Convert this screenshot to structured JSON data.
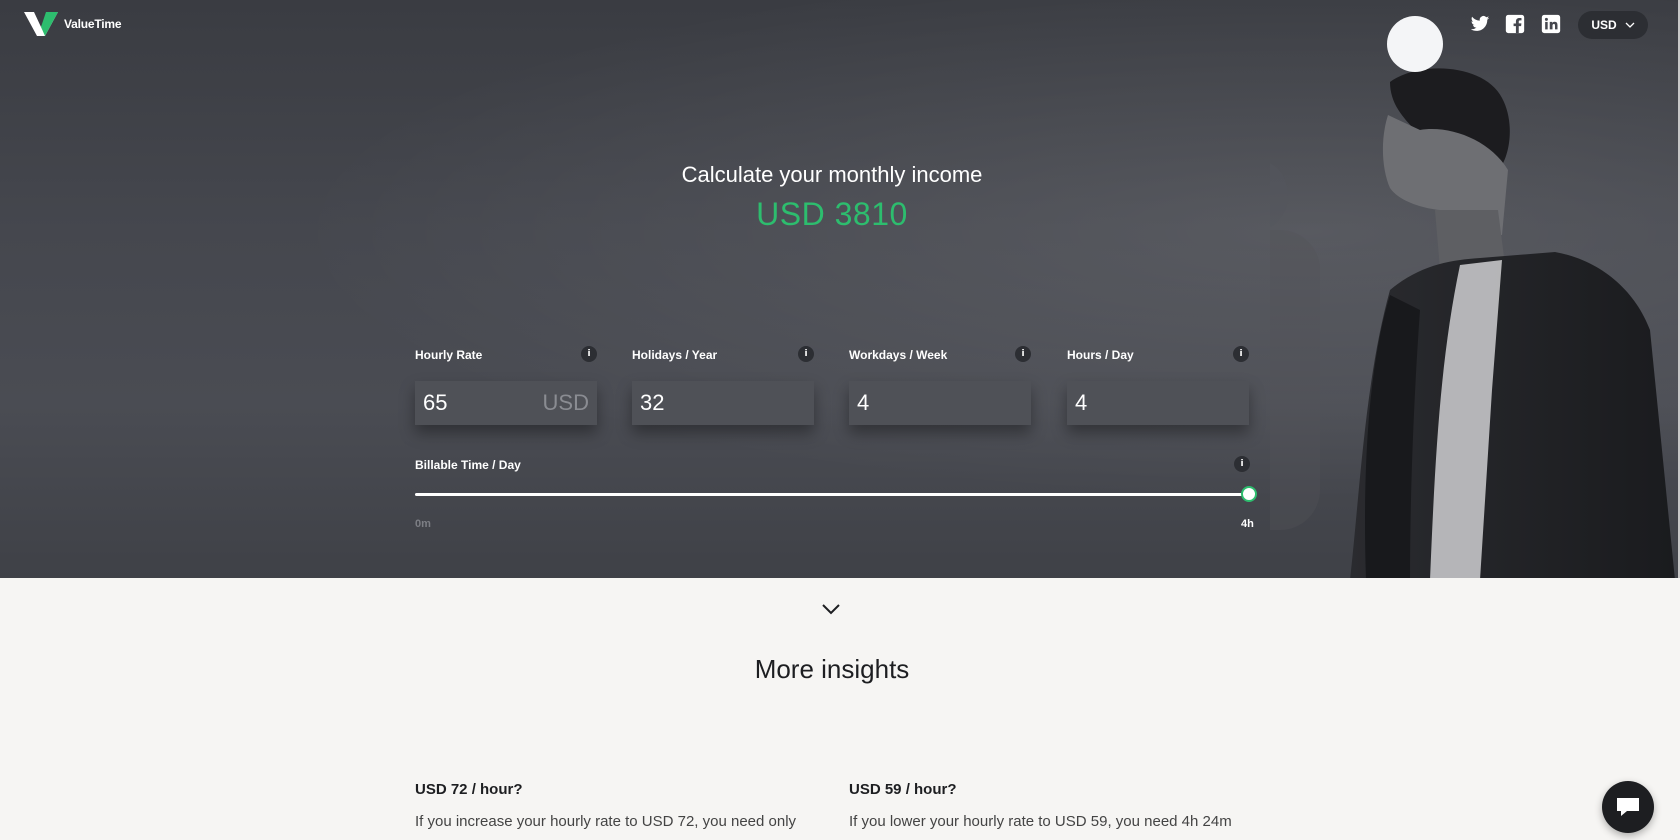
{
  "brand": {
    "name": "ValueTime"
  },
  "header": {
    "social": [
      "twitter-icon",
      "facebook-icon",
      "linkedin-icon"
    ],
    "currency": "USD"
  },
  "hero": {
    "title": "Calculate your monthly income",
    "amount": "USD 3810",
    "accent_color": "#2dbd6e"
  },
  "fields": [
    {
      "label": "Hourly Rate",
      "value": "65",
      "unit": "USD"
    },
    {
      "label": "Holidays / Year",
      "value": "32"
    },
    {
      "label": "Workdays / Week",
      "value": "4"
    },
    {
      "label": "Hours / Day",
      "value": "4"
    }
  ],
  "info_glyph": "i",
  "slider": {
    "label": "Billable Time / Day",
    "min_label": "0m",
    "max_label": "4h",
    "value_fraction": 1.0
  },
  "insights": {
    "title": "More insights",
    "items": [
      {
        "title": "USD 72 / hour?",
        "text": "If you increase your hourly rate to USD 72, you need only"
      },
      {
        "title": "USD 59 / hour?",
        "text": "If you lower your hourly rate to USD 59, you need 4h 24m"
      }
    ]
  }
}
